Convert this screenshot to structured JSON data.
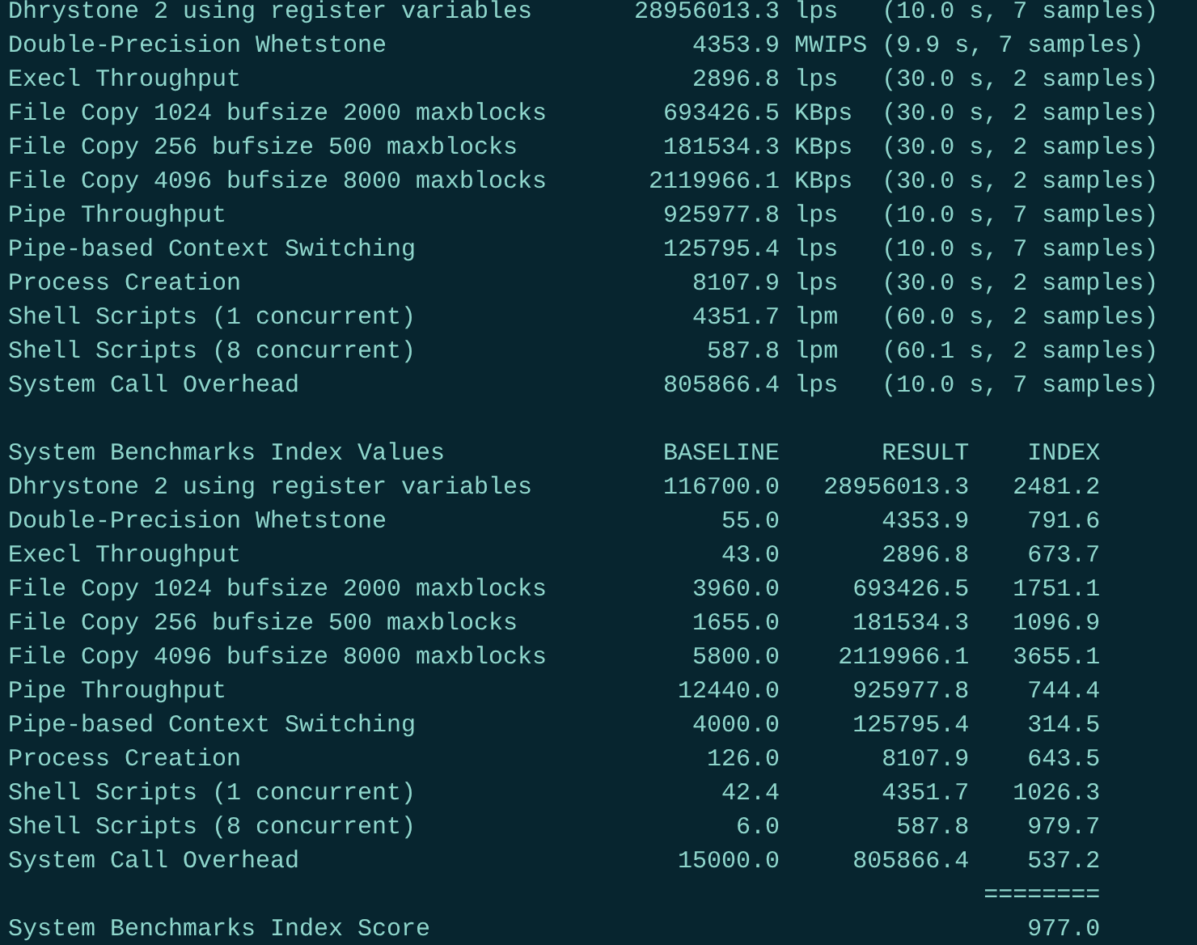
{
  "results": [
    {
      "test": "Dhrystone 2 using register variables",
      "value": "28956013.3",
      "unit": "lps",
      "timing": "(10.0 s, 7 samples)"
    },
    {
      "test": "Double-Precision Whetstone",
      "value": "4353.9",
      "unit": "MWIPS",
      "timing": "(9.9 s, 7 samples)"
    },
    {
      "test": "Execl Throughput",
      "value": "2896.8",
      "unit": "lps",
      "timing": "(30.0 s, 2 samples)"
    },
    {
      "test": "File Copy 1024 bufsize 2000 maxblocks",
      "value": "693426.5",
      "unit": "KBps",
      "timing": "(30.0 s, 2 samples)"
    },
    {
      "test": "File Copy 256 bufsize 500 maxblocks",
      "value": "181534.3",
      "unit": "KBps",
      "timing": "(30.0 s, 2 samples)"
    },
    {
      "test": "File Copy 4096 bufsize 8000 maxblocks",
      "value": "2119966.1",
      "unit": "KBps",
      "timing": "(30.0 s, 2 samples)"
    },
    {
      "test": "Pipe Throughput",
      "value": "925977.8",
      "unit": "lps",
      "timing": "(10.0 s, 7 samples)"
    },
    {
      "test": "Pipe-based Context Switching",
      "value": "125795.4",
      "unit": "lps",
      "timing": "(10.0 s, 7 samples)"
    },
    {
      "test": "Process Creation",
      "value": "8107.9",
      "unit": "lps",
      "timing": "(30.0 s, 2 samples)"
    },
    {
      "test": "Shell Scripts (1 concurrent)",
      "value": "4351.7",
      "unit": "lpm",
      "timing": "(60.0 s, 2 samples)"
    },
    {
      "test": "Shell Scripts (8 concurrent)",
      "value": "587.8",
      "unit": "lpm",
      "timing": "(60.1 s, 2 samples)"
    },
    {
      "test": "System Call Overhead",
      "value": "805866.4",
      "unit": "lps",
      "timing": "(10.0 s, 7 samples)"
    }
  ],
  "index_table": {
    "title": "System Benchmarks Index Values",
    "columns": [
      "BASELINE",
      "RESULT",
      "INDEX"
    ],
    "rows": [
      {
        "test": "Dhrystone 2 using register variables",
        "baseline": "116700.0",
        "result": "28956013.3",
        "index": "2481.2"
      },
      {
        "test": "Double-Precision Whetstone",
        "baseline": "55.0",
        "result": "4353.9",
        "index": "791.6"
      },
      {
        "test": "Execl Throughput",
        "baseline": "43.0",
        "result": "2896.8",
        "index": "673.7"
      },
      {
        "test": "File Copy 1024 bufsize 2000 maxblocks",
        "baseline": "3960.0",
        "result": "693426.5",
        "index": "1751.1"
      },
      {
        "test": "File Copy 256 bufsize 500 maxblocks",
        "baseline": "1655.0",
        "result": "181534.3",
        "index": "1096.9"
      },
      {
        "test": "File Copy 4096 bufsize 8000 maxblocks",
        "baseline": "5800.0",
        "result": "2119966.1",
        "index": "3655.1"
      },
      {
        "test": "Pipe Throughput",
        "baseline": "12440.0",
        "result": "925977.8",
        "index": "744.4"
      },
      {
        "test": "Pipe-based Context Switching",
        "baseline": "4000.0",
        "result": "125795.4",
        "index": "314.5"
      },
      {
        "test": "Process Creation",
        "baseline": "126.0",
        "result": "8107.9",
        "index": "643.5"
      },
      {
        "test": "Shell Scripts (1 concurrent)",
        "baseline": "42.4",
        "result": "4351.7",
        "index": "1026.3"
      },
      {
        "test": "Shell Scripts (8 concurrent)",
        "baseline": "6.0",
        "result": "587.8",
        "index": "979.7"
      },
      {
        "test": "System Call Overhead",
        "baseline": "15000.0",
        "result": "805866.4",
        "index": "537.2"
      }
    ]
  },
  "separator": "========",
  "score": {
    "label": "System Benchmarks Index Score",
    "value": "977.0"
  }
}
